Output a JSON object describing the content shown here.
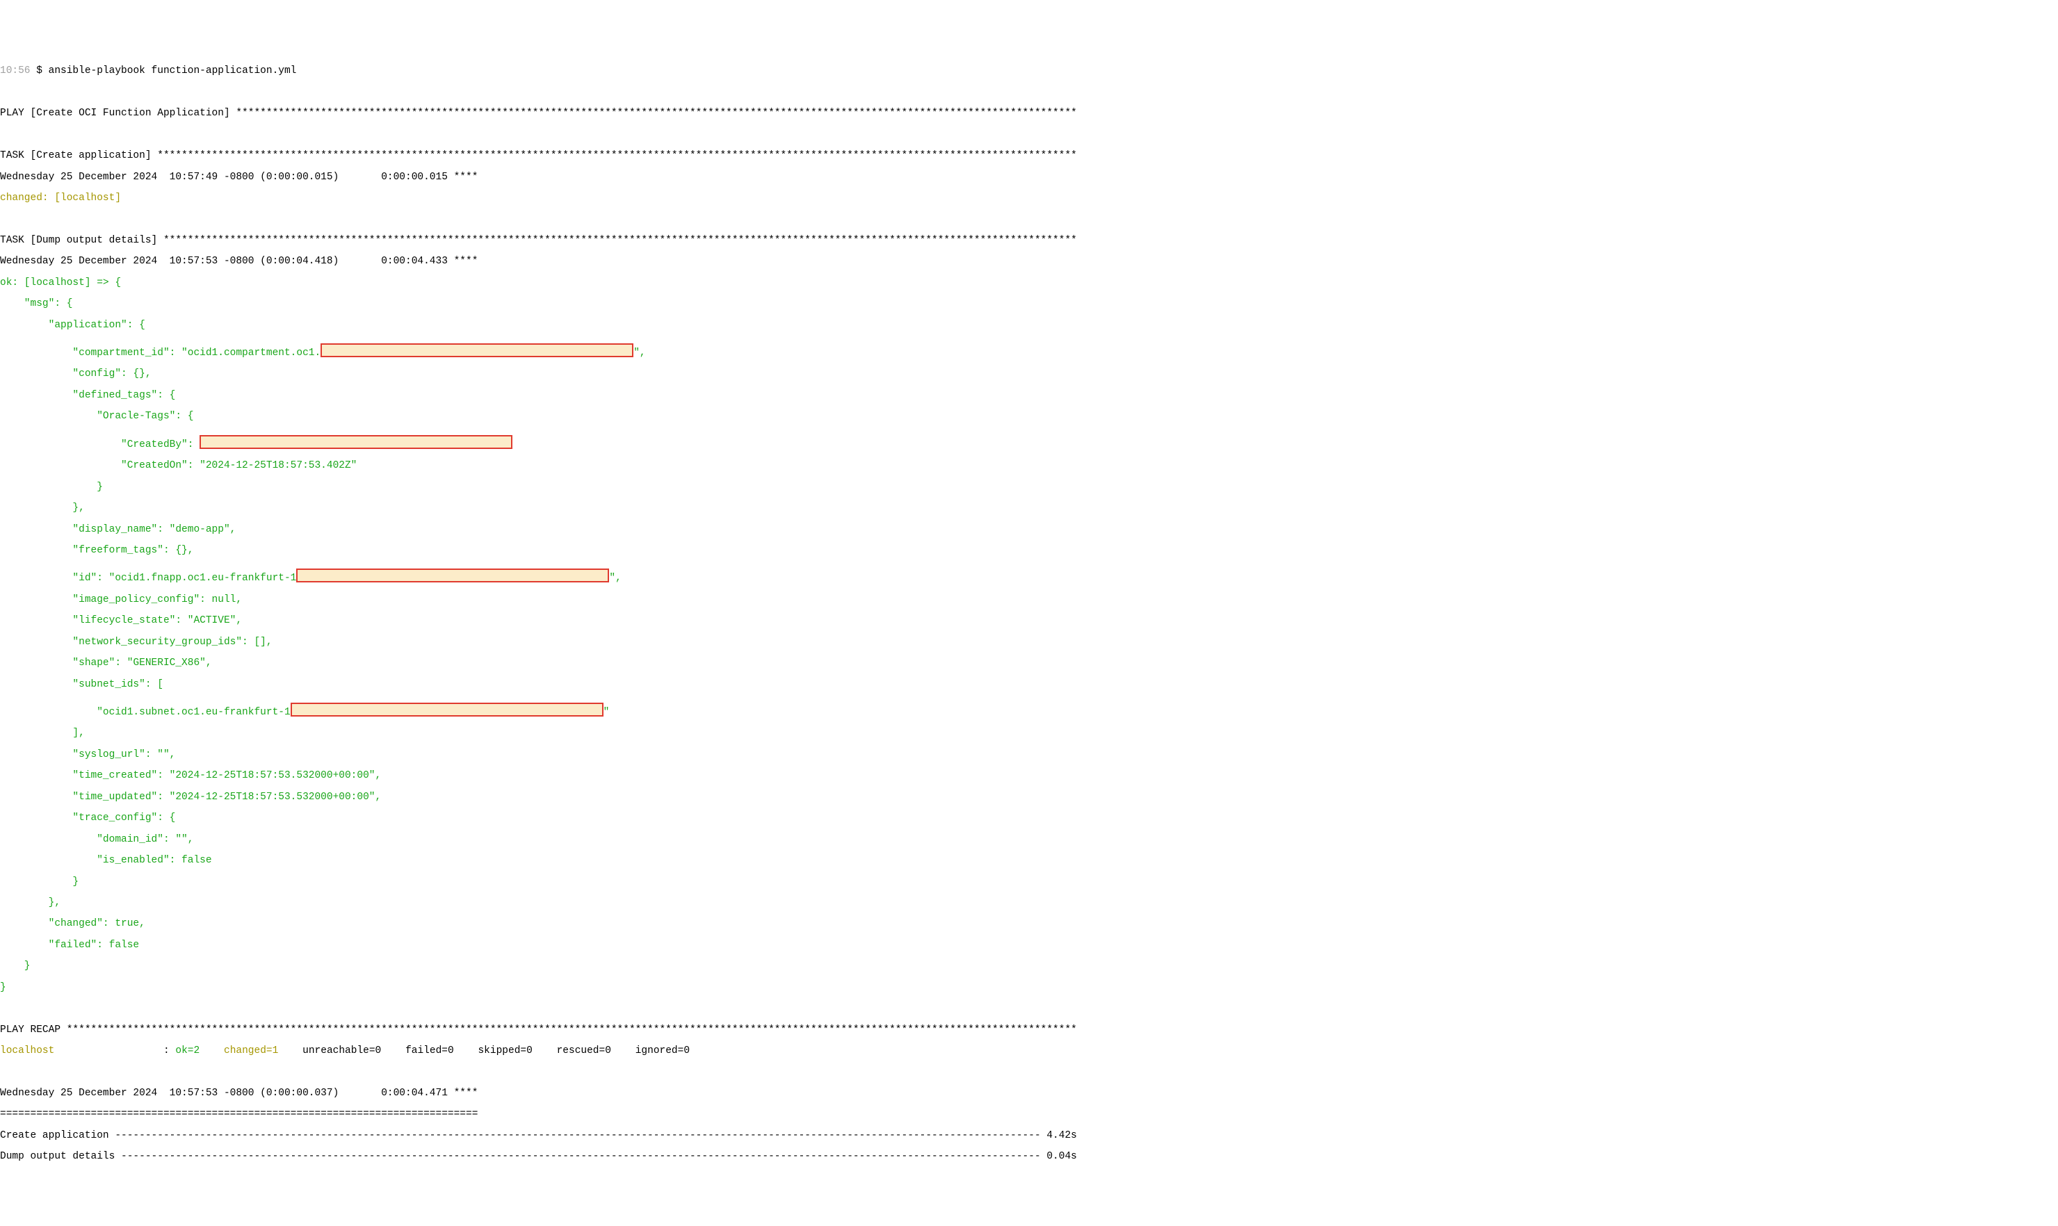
{
  "prompt": {
    "time": "10:56",
    "dollar": "$",
    "cmd": "ansible-playbook function-application.yml"
  },
  "play_header": {
    "label": "PLAY",
    "name": "Create OCI Function Application"
  },
  "task1": {
    "label": "TASK",
    "name": "Create application",
    "timestamp": "Wednesday 25 December 2024  10:57:49 -0800 (0:00:00.015)       0:00:00.015 ****",
    "status": "changed: [localhost]"
  },
  "task2": {
    "label": "TASK",
    "name": "Dump output details",
    "timestamp": "Wednesday 25 December 2024  10:57:53 -0800 (0:00:04.418)       0:00:04.433 ****",
    "status": "ok: [localhost] => {"
  },
  "msg": {
    "open": "    \"msg\": {",
    "app_open": "        \"application\": {",
    "compartment_pre": "            \"compartment_id\": \"ocid1.compartment.oc1.",
    "compartment_suf": "\",",
    "config": "            \"config\": {},",
    "defined_open": "            \"defined_tags\": {",
    "oracle_open": "                \"Oracle-Tags\": {",
    "createdby_pre": "                    \"CreatedBy\": ",
    "createdon": "                    \"CreatedOn\": \"2024-12-25T18:57:53.402Z\"",
    "oracle_close": "                }",
    "defined_close": "            },",
    "display_name": "            \"display_name\": \"demo-app\",",
    "freeform": "            \"freeform_tags\": {},",
    "id_pre": "            \"id\": \"ocid1.fnapp.oc1.eu-frankfurt-1",
    "id_suf": "\",",
    "image_policy": "            \"image_policy_config\": null,",
    "lifecycle": "            \"lifecycle_state\": \"ACTIVE\",",
    "nsg": "            \"network_security_group_ids\": [],",
    "shape": "            \"shape\": \"GENERIC_X86\",",
    "subnet_open": "            \"subnet_ids\": [",
    "subnet_pre": "                \"ocid1.subnet.oc1.eu-frankfurt-1",
    "subnet_suf": "\"",
    "subnet_close": "            ],",
    "syslog": "            \"syslog_url\": \"\",",
    "time_created": "            \"time_created\": \"2024-12-25T18:57:53.532000+00:00\",",
    "time_updated": "            \"time_updated\": \"2024-12-25T18:57:53.532000+00:00\",",
    "trace_open": "            \"trace_config\": {",
    "domain_id": "                \"domain_id\": \"\",",
    "is_enabled": "                \"is_enabled\": false",
    "trace_close": "            }",
    "app_close": "        },",
    "changed": "        \"changed\": true,",
    "failed": "        \"failed\": false",
    "msg_close": "    }",
    "outer_close": "}"
  },
  "recap": {
    "label": "PLAY RECAP",
    "host": "localhost",
    "colon": ":",
    "ok": "ok=2",
    "changed": "changed=1",
    "rest": "unreachable=0    failed=0    skipped=0    rescued=0    ignored=0"
  },
  "timing": {
    "summary": "Wednesday 25 December 2024  10:57:53 -0800 (0:00:00.037)       0:00:04.471 ****",
    "divider": "===============================================================================",
    "row1_name": "Create application ",
    "row1_time": " 4.42s",
    "row2_name": "Dump output details ",
    "row2_time": " 0.04s"
  },
  "stars_full": "******************************************************************************************************************************************************************************************************************",
  "dashes_full": "-------------------------------------------------------------------------------------------------------------------------------------------------------------------------------------------------------------"
}
